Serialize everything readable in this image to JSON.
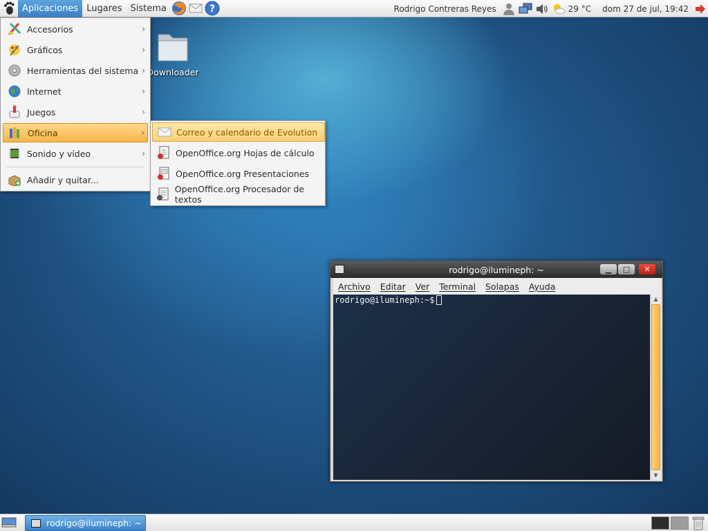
{
  "top_panel": {
    "menus": [
      "Aplicaciones",
      "Lugares",
      "Sistema"
    ],
    "user": "Rodrigo Contreras Reyes",
    "weather": "29 °C",
    "datetime": "dom 27 de jul, 19:42"
  },
  "app_menu": {
    "items": [
      {
        "label": "Accesorios",
        "icon": "accessories-icon"
      },
      {
        "label": "Gráficos",
        "icon": "graphics-icon"
      },
      {
        "label": "Herramientas del sistema",
        "icon": "system-tools-icon"
      },
      {
        "label": "Internet",
        "icon": "internet-globe-icon"
      },
      {
        "label": "Juegos",
        "icon": "games-icon"
      },
      {
        "label": "Oficina",
        "icon": "office-icon"
      },
      {
        "label": "Sonido y vídeo",
        "icon": "multimedia-icon"
      }
    ],
    "add_remove": "Añadir y quitar..."
  },
  "office_submenu": {
    "items": [
      {
        "label": "Correo y calendario de Evolution",
        "icon": "evolution-mail-icon"
      },
      {
        "label": "OpenOffice.org Hojas de cálculo",
        "icon": "spreadsheet-icon"
      },
      {
        "label": "OpenOffice.org Presentaciones",
        "icon": "presentation-icon"
      },
      {
        "label": "OpenOffice.org Procesador de textos",
        "icon": "word-processor-icon"
      }
    ]
  },
  "desktop": {
    "folder_label": "Downloader"
  },
  "terminal": {
    "title": "rodrigo@ilumineph: ~",
    "menus": [
      "Archivo",
      "Editar",
      "Ver",
      "Terminal",
      "Solapas",
      "Ayuda"
    ],
    "prompt": "rodrigo@ilumineph:~$"
  },
  "bottom_panel": {
    "task_label": "rodrigo@ilumineph: ~"
  },
  "colors": {
    "highlight": "#f8b54a",
    "panel_selected": "#3b7fc4",
    "terminal_bg": "#1a2333"
  }
}
